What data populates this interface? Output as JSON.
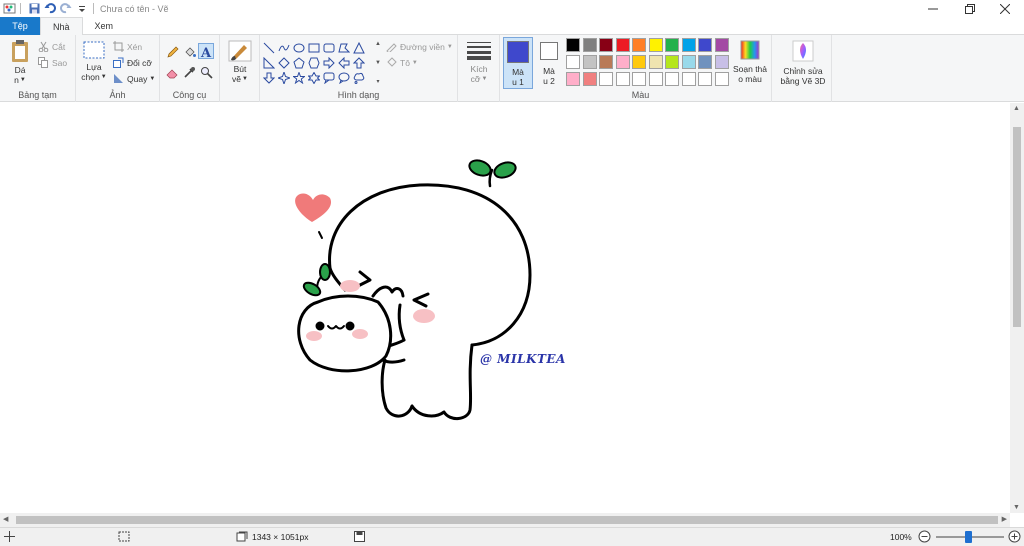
{
  "window": {
    "title": "Chưa có tên - Vẽ"
  },
  "tabs": [
    {
      "label": "Tệp"
    },
    {
      "label": "Nhà"
    },
    {
      "label": "Xem"
    }
  ],
  "groups": {
    "clipboard": {
      "label": "Bảng tạm",
      "paste_line1": "Dá",
      "paste_line2": "n",
      "cut": "Cắt",
      "copy": "Sao"
    },
    "image": {
      "label": "Ảnh",
      "select_line1": "Lựa",
      "select_line2": "chọn",
      "crop": "Xén",
      "resize": "Đổi cỡ",
      "rotate": "Quay"
    },
    "tools": {
      "label": "Công cụ"
    },
    "brushes": {
      "label_line1": "Bút",
      "label_line2": "vẽ"
    },
    "shapes": {
      "label": "Hình dạng",
      "outline": "Đường viền",
      "fill": "Tô"
    },
    "size": {
      "label_line1": "Kích",
      "label_line2": "cỡ"
    },
    "colors": {
      "label": "Màu",
      "color1_line1": "Mà",
      "color1_line2": "u 1",
      "color2_line1": "Mà",
      "color2_line2": "u 2",
      "color1_value": "#3f48cc",
      "color2_value": "#ffffff",
      "palette_row1": [
        "#000000",
        "#7f7f7f",
        "#880015",
        "#ed1c24",
        "#ff7f27",
        "#fff200",
        "#22b14c",
        "#00a2e8",
        "#3f48cc",
        "#a349a4"
      ],
      "palette_row2": [
        "#ffffff",
        "#c3c3c3",
        "#b97a57",
        "#ffaec9",
        "#ffc90e",
        "#efe4b0",
        "#b5e61d",
        "#99d9ea",
        "#7092be",
        "#c8bfe7"
      ],
      "palette_row3": [
        "#ffaec9",
        "#f08080",
        "#ffffff",
        "#ffffff",
        "#ffffff",
        "#ffffff",
        "#ffffff",
        "#ffffff",
        "#ffffff",
        "#ffffff"
      ],
      "edit_colors_line1": "Soạn thả",
      "edit_colors_line2": "o màu"
    },
    "paint3d": {
      "line1": "Chỉnh sửa",
      "line2": "bằng Vẽ 3D"
    }
  },
  "canvas": {
    "watermark": "@ MILKTEA"
  },
  "status": {
    "dimensions": "1343 × 1051px",
    "zoom": "100%"
  }
}
